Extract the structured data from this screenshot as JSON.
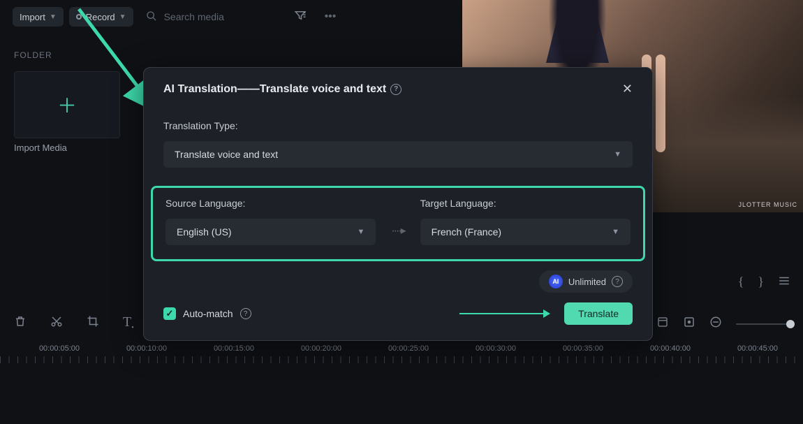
{
  "toolbar": {
    "import_label": "Import",
    "record_label": "Record",
    "search_placeholder": "Search media"
  },
  "folder": {
    "section_label": "FOLDER",
    "import_tile_label": "Import Media"
  },
  "preview": {
    "watermark": "JLOTTER MUSIC"
  },
  "modal": {
    "title": "AI Translation——Translate voice and text",
    "translation_type_label": "Translation Type:",
    "translation_type_value": "Translate voice and text",
    "source_label": "Source Language:",
    "source_value": "English (US)",
    "target_label": "Target Language:",
    "target_value": "French (France)",
    "unlimited_label": "Unlimited",
    "ai_badge": "AI",
    "auto_match_label": "Auto-match",
    "translate_btn": "Translate"
  },
  "timeline": {
    "labels": [
      "00:00:05:00",
      "00:00:10:00",
      "00:00:15:00",
      "00:00:20:00",
      "00:00:25:00",
      "00:00:30:00",
      "00:00:35:00",
      "00:00:40:00",
      "00:00:45:00"
    ]
  }
}
